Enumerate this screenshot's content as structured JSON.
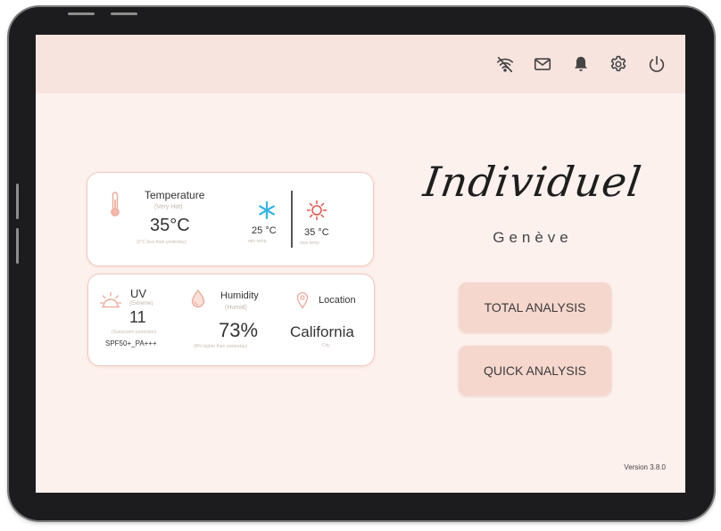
{
  "topbar": {
    "icons": [
      "wifi-off-icon",
      "mail-icon",
      "bell-icon",
      "gear-icon",
      "power-icon"
    ]
  },
  "temperature": {
    "label": "Temperature",
    "status": "(Very Hot)",
    "value": "35°C",
    "note": "(2°C less than yesterday)",
    "min_value": "25 °C",
    "min_caption": "min temp",
    "max_value": "35 °C",
    "max_caption": "max temp"
  },
  "uv": {
    "label": "UV",
    "status": "(Extreme)",
    "value": "11",
    "note": "(Sunscreen protection)",
    "recommendation": "SPF50+_PA+++"
  },
  "humidity": {
    "label": "Humidity",
    "status": "(Humid)",
    "value": "73%",
    "note": "(8% higher than yesterday)"
  },
  "location": {
    "label": "Location",
    "value": "California",
    "caption": "City"
  },
  "brand": {
    "name": "Individuel",
    "city": "Genève"
  },
  "actions": {
    "total": "TOTAL ANALYSIS",
    "quick": "QUICK ANALYSIS"
  },
  "version": "Version 3.8.0",
  "colors": {
    "accent": "#f6d7cd",
    "topbar": "#f8e4de",
    "background": "#fdf1ee",
    "card_border": "#efc9bd",
    "snow": "#38b4e6",
    "sun": "#e0564a"
  }
}
